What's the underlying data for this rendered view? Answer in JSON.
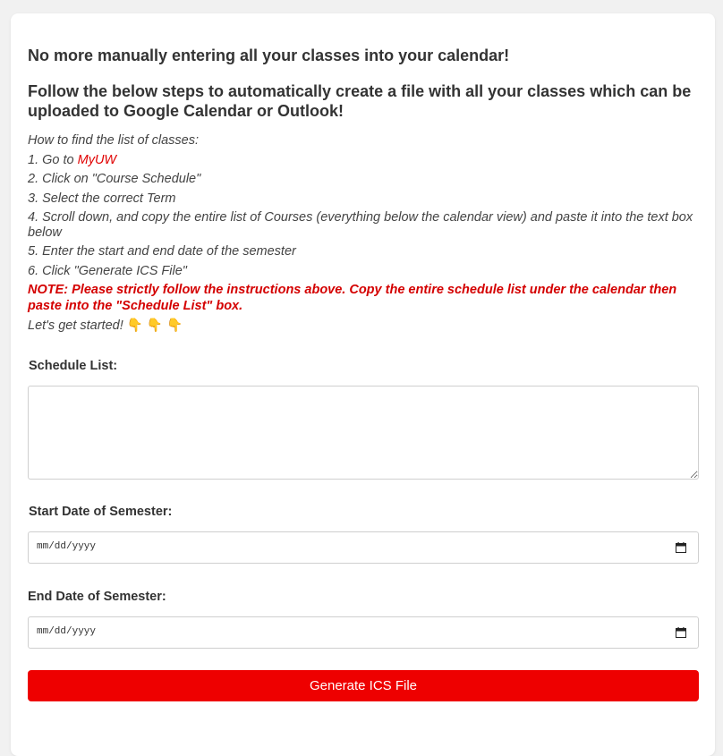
{
  "headings": {
    "line1": "No more manually entering all your classes into your calendar!",
    "line2": "Follow the below steps to automatically create a file with all your classes which can be uploaded to Google Calendar or Outlook!"
  },
  "instructions": {
    "intro": "How to find the list of classes:",
    "step1_prefix": "1. Go to ",
    "step1_link": "MyUW",
    "step2": "2. Click on \"Course Schedule\"",
    "step3": "3. Select the correct Term",
    "step4": "4. Scroll down, and copy the entire list of Courses (everything below the calendar view) and paste it into the text box below",
    "step5": "5. Enter the start and end date of the semester",
    "step6": "6. Click \"Generate ICS File\""
  },
  "note": "NOTE: Please strictly follow the instructions above. Copy the entire schedule list under the calendar then paste into the \"Schedule List\" box.",
  "start_text": "Let's get started!",
  "start_emoji": "👇 👇 👇",
  "form": {
    "schedule_label": "Schedule List:",
    "schedule_value": "",
    "start_label": "Start Date of Semester:",
    "start_placeholder": "mm/dd/yyyy",
    "end_label": "End Date of Semester:",
    "end_placeholder": "mm/dd/yyyy",
    "generate_label": "Generate ICS File"
  },
  "colors": {
    "accent": "#ee0000",
    "link": "#e00000",
    "note": "#d40000"
  },
  "icons": {
    "date_picker": "calendar-icon",
    "pointer": "pointing-down-emoji"
  }
}
